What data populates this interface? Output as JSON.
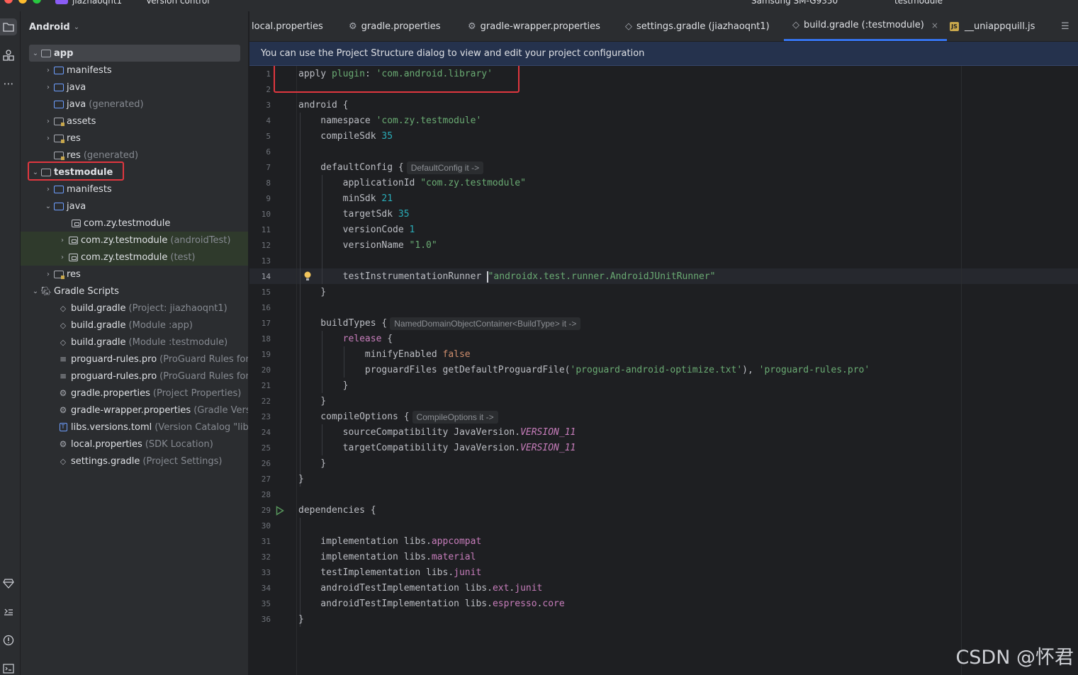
{
  "titlebar": {
    "project": "jiazhaoqnt1",
    "vcs": "Version control",
    "device": "Samsung SM-G9350",
    "config": "testmodule"
  },
  "project_panel": {
    "view_label": "Android",
    "tree": [
      {
        "name": "app",
        "hint": ""
      },
      {
        "name": "manifests",
        "hint": ""
      },
      {
        "name": "java",
        "hint": ""
      },
      {
        "name": "java",
        "hint": "(generated)"
      },
      {
        "name": "assets",
        "hint": ""
      },
      {
        "name": "res",
        "hint": ""
      },
      {
        "name": "res",
        "hint": "(generated)"
      },
      {
        "name": "testmodule",
        "hint": ""
      },
      {
        "name": "manifests",
        "hint": ""
      },
      {
        "name": "java",
        "hint": ""
      },
      {
        "name": "com.zy.testmodule",
        "hint": ""
      },
      {
        "name": "com.zy.testmodule",
        "hint": "(androidTest)"
      },
      {
        "name": "com.zy.testmodule",
        "hint": "(test)"
      },
      {
        "name": "res",
        "hint": ""
      },
      {
        "name": "Gradle Scripts",
        "hint": ""
      },
      {
        "name": "build.gradle",
        "hint": "(Project: jiazhaoqnt1)"
      },
      {
        "name": "build.gradle",
        "hint": "(Module :app)"
      },
      {
        "name": "build.gradle",
        "hint": "(Module :testmodule)"
      },
      {
        "name": "proguard-rules.pro",
        "hint": "(ProGuard Rules for \":"
      },
      {
        "name": "proguard-rules.pro",
        "hint": "(ProGuard Rules for \":"
      },
      {
        "name": "gradle.properties",
        "hint": "(Project Properties)"
      },
      {
        "name": "gradle-wrapper.properties",
        "hint": "(Gradle Versio"
      },
      {
        "name": "libs.versions.toml",
        "hint": "(Version Catalog \"libs\")"
      },
      {
        "name": "local.properties",
        "hint": "(SDK Location)"
      },
      {
        "name": "settings.gradle",
        "hint": "(Project Settings)"
      }
    ]
  },
  "tabs": [
    {
      "label": "local.properties"
    },
    {
      "label": "gradle.properties"
    },
    {
      "label": "gradle-wrapper.properties"
    },
    {
      "label": "settings.gradle (jiazhaoqnt1)"
    },
    {
      "label": "build.gradle (:testmodule)"
    },
    {
      "label": "__uniappquill.js"
    }
  ],
  "banner": "You can use the Project Structure dialog to view and edit your project configuration",
  "editor": {
    "line_numbers": [
      "1",
      "2",
      "3",
      "4",
      "5",
      "6",
      "7",
      "8",
      "9",
      "10",
      "11",
      "12",
      "13",
      "14",
      "15",
      "16",
      "17",
      "18",
      "19",
      "20",
      "21",
      "22",
      "23",
      "24",
      "25",
      "26",
      "27",
      "28",
      "29",
      "30",
      "31",
      "32",
      "33",
      "34",
      "35",
      "36"
    ],
    "current_line": "14",
    "inlay_defaultconfig": "DefaultConfig it ->",
    "inlay_buildtypes": "NamedDomainObjectContainer<BuildType> it ->",
    "inlay_compileoptions": "CompileOptions it ->",
    "lines": {
      "l1_a": "apply ",
      "l1_b": "plugin",
      "l1_c": ": ",
      "l1_d": "'com.android.library'",
      "l3": "android {",
      "l4_a": "    namespace ",
      "l4_b": "'com.zy.testmodule'",
      "l5_a": "    compileSdk ",
      "l5_b": "35",
      "l7_a": "    defaultConfig {",
      "l8_a": "        applicationId ",
      "l8_b": "\"com.zy.testmodule\"",
      "l9_a": "        minSdk ",
      "l9_b": "21",
      "l10_a": "        targetSdk ",
      "l10_b": "35",
      "l11_a": "        versionCode ",
      "l11_b": "1",
      "l12_a": "        versionName ",
      "l12_b": "\"1.0\"",
      "l14_a": "        testInstrumentationRunner ",
      "l14_b": "\"androidx.test.runner.AndroidJUnitRunner\"",
      "l15": "    }",
      "l17_a": "    buildTypes {",
      "l18_a": "        ",
      "l18_b": "release",
      "l18_c": " {",
      "l19_a": "            minifyEnabled ",
      "l19_b": "false",
      "l20_a": "            proguardFiles getDefaultProguardFile(",
      "l20_b": "'proguard-android-optimize.txt'",
      "l20_c": "), ",
      "l20_d": "'proguard-rules.pro'",
      "l21": "        }",
      "l22": "    }",
      "l23_a": "    compileOptions {",
      "l24_a": "        sourceCompatibility JavaVersion.",
      "l24_b": "VERSION_11",
      "l25_a": "        targetCompatibility JavaVersion.",
      "l25_b": "VERSION_11",
      "l26": "    }",
      "l27": "}",
      "l29": "dependencies {",
      "l31_a": "    implementation libs.",
      "l31_b": "appcompat",
      "l32_a": "    implementation libs.",
      "l32_b": "material",
      "l33_a": "    testImplementation libs.",
      "l33_b": "junit",
      "l34_a": "    androidTestImplementation libs.",
      "l34_b": "ext",
      "l34_c": ".",
      "l34_d": "junit",
      "l35_a": "    androidTestImplementation libs.",
      "l35_b": "espresso",
      "l35_c": ".",
      "l35_d": "core",
      "l36": "}"
    }
  },
  "watermark": "CSDN @怀君",
  "colors": {
    "accent": "#3574f0",
    "annotation_red": "#e0373f",
    "string": "#6aab73",
    "keyword": "#cf8e6d",
    "number": "#2aacb8"
  }
}
